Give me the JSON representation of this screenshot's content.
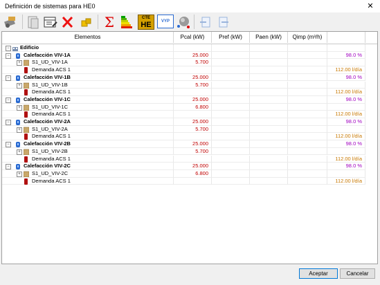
{
  "window": {
    "title": "Definición de sistemas para HE0",
    "close_glyph": "✕"
  },
  "toolbar": {
    "icons": [
      "tools-icon",
      "document-icon",
      "edit-table-icon",
      "delete-icon",
      "puzzle-icon",
      "sum-icon",
      "energy-rating-icon",
      "cte-he-icon",
      "vyp-icon",
      "sphere-icon",
      "import-icon",
      "export-icon"
    ],
    "sum_glyph": "Σ",
    "cte_top": "CTE",
    "cte_bottom": "HE",
    "vyp_text": "VYP"
  },
  "table": {
    "columns": [
      "Elementos",
      "Pcal (kW)",
      "Pref (kW)",
      "Paen (kW)",
      "Qimp (m³/h)",
      ""
    ],
    "root_label": "Edificio",
    "groups": [
      {
        "name": "Calefacción VIV-1A",
        "pcal": "25.000",
        "pct": "98.0 %",
        "sub": {
          "name": "S1_UD_VIV-1A",
          "pcal": "5.700"
        },
        "acs": {
          "name": "Demanda ACS 1",
          "value": "112.00 l/día"
        }
      },
      {
        "name": "Calefacción VIV-1B",
        "pcal": "25.000",
        "pct": "98.0 %",
        "sub": {
          "name": "S1_UD_VIV-1B",
          "pcal": "5.700"
        },
        "acs": {
          "name": "Demanda ACS 1",
          "value": "112.00 l/día"
        }
      },
      {
        "name": "Calefacción VIV-1C",
        "pcal": "25.000",
        "pct": "98.0 %",
        "sub": {
          "name": "S1_UD_VIV-1C",
          "pcal": "6.800"
        },
        "acs": {
          "name": "Demanda ACS 1",
          "value": "112.00 l/día"
        }
      },
      {
        "name": "Calefacción VIV-2A",
        "pcal": "25.000",
        "pct": "98.0 %",
        "sub": {
          "name": "S1_UD_VIV-2A",
          "pcal": "5.700"
        },
        "acs": {
          "name": "Demanda ACS 1",
          "value": "112.00 l/día"
        }
      },
      {
        "name": "Calefacción VIV-2B",
        "pcal": "25.000",
        "pct": "98.0 %",
        "sub": {
          "name": "S1_UD_VIV-2B",
          "pcal": "5.700"
        },
        "acs": {
          "name": "Demanda ACS 1",
          "value": "112.00 l/día"
        }
      },
      {
        "name": "Calefacción VIV-2C",
        "pcal": "25.000",
        "pct": "98.0 %",
        "sub": {
          "name": "S1_UD_VIV-2C",
          "pcal": "6.800"
        },
        "acs": {
          "name": "Demanda ACS 1",
          "value": "112.00 l/día"
        }
      }
    ]
  },
  "buttons": {
    "accept": "Aceptar",
    "cancel": "Cancelar"
  },
  "colors": {
    "value_red": "#c00000",
    "percent_purple": "#a000c0",
    "acs_orange": "#c87800",
    "accent": "#0078d7"
  }
}
